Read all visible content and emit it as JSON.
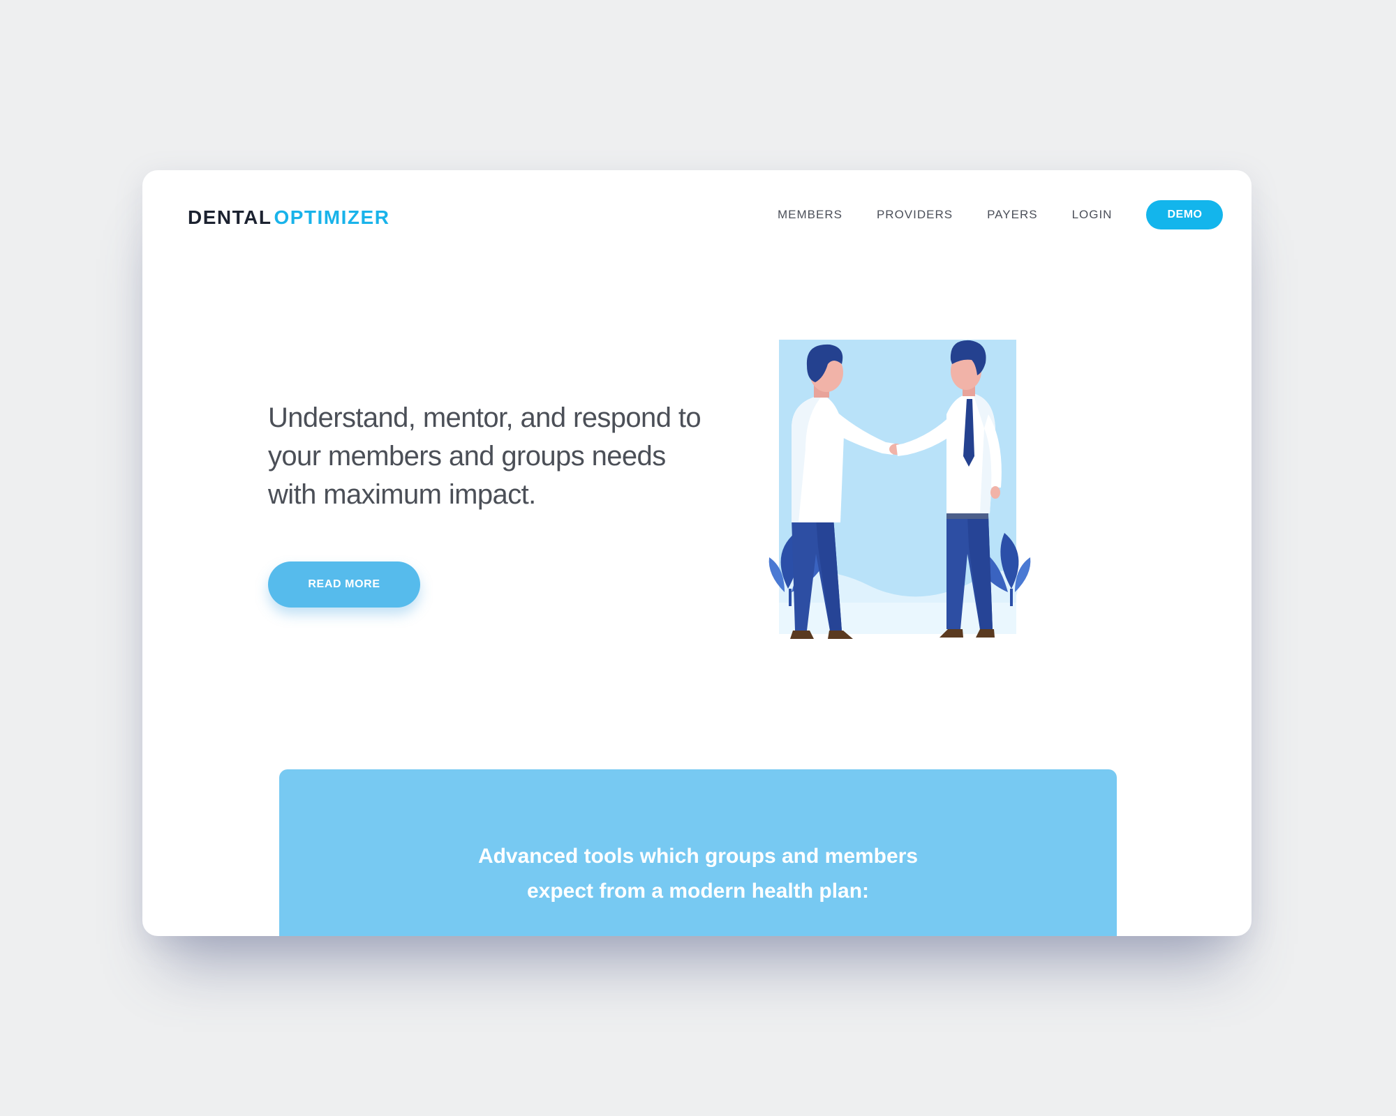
{
  "brand": {
    "name_part1": "DENTAL",
    "name_part2": "OPTIMIZER"
  },
  "nav": {
    "items": [
      "MEMBERS",
      "PROVIDERS",
      "PAYERS",
      "LOGIN"
    ],
    "demo_label": "DEMO"
  },
  "hero": {
    "headline": "Understand, mentor, and respond to your members and groups needs with maximum impact.",
    "cta_label": "READ MORE",
    "illustration": "handshake-illustration"
  },
  "feature": {
    "line1": "Advanced tools which groups and members",
    "line2": "expect from a modern health plan:"
  },
  "colors": {
    "accent": "#13b5ec",
    "button": "#56bbec",
    "panel": "#77c9f2",
    "text": "#4b4f57",
    "dark": "#1c2230"
  }
}
